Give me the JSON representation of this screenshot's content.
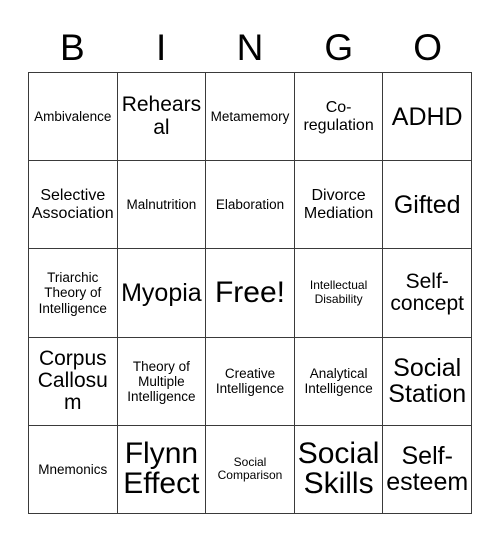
{
  "card": {
    "title": "BINGO",
    "header_letters": [
      "B",
      "I",
      "N",
      "G",
      "O"
    ],
    "free_space_label": "Free!",
    "grid_size": "5x5",
    "colors": {
      "background": "#ffffff",
      "text": "#000000",
      "border": "#3a3a3a"
    },
    "rows": [
      [
        {
          "text": "Ambivalence",
          "size": "sm"
        },
        {
          "text": "Rehearsal",
          "size": "lg"
        },
        {
          "text": "Metamemory",
          "size": "sm"
        },
        {
          "text": "Co-regulation",
          "size": "md"
        },
        {
          "text": "ADHD",
          "size": "xl"
        }
      ],
      [
        {
          "text": "Selective Association",
          "size": "md"
        },
        {
          "text": "Malnutrition",
          "size": "sm"
        },
        {
          "text": "Elaboration",
          "size": "sm"
        },
        {
          "text": "Divorce Mediation",
          "size": "md"
        },
        {
          "text": "Gifted",
          "size": "xl"
        }
      ],
      [
        {
          "text": "Triarchic Theory of Intelligence",
          "size": "sm"
        },
        {
          "text": "Myopia",
          "size": "xl"
        },
        {
          "text": "Free!",
          "size": "xxl"
        },
        {
          "text": "Intellectual Disability",
          "size": "xs"
        },
        {
          "text": "Self-concept",
          "size": "lg"
        }
      ],
      [
        {
          "text": "Corpus Callosum",
          "size": "lg"
        },
        {
          "text": "Theory of Multiple Intelligence",
          "size": "sm"
        },
        {
          "text": "Creative Intelligence",
          "size": "sm"
        },
        {
          "text": "Analytical Intelligence",
          "size": "sm"
        },
        {
          "text": "Social Station",
          "size": "xl"
        }
      ],
      [
        {
          "text": "Mnemonics",
          "size": "sm"
        },
        {
          "text": "Flynn Effect",
          "size": "xxl"
        },
        {
          "text": "Social Comparison",
          "size": "xs"
        },
        {
          "text": "Social Skills",
          "size": "xxl"
        },
        {
          "text": "Self-esteem",
          "size": "xl"
        }
      ]
    ]
  }
}
